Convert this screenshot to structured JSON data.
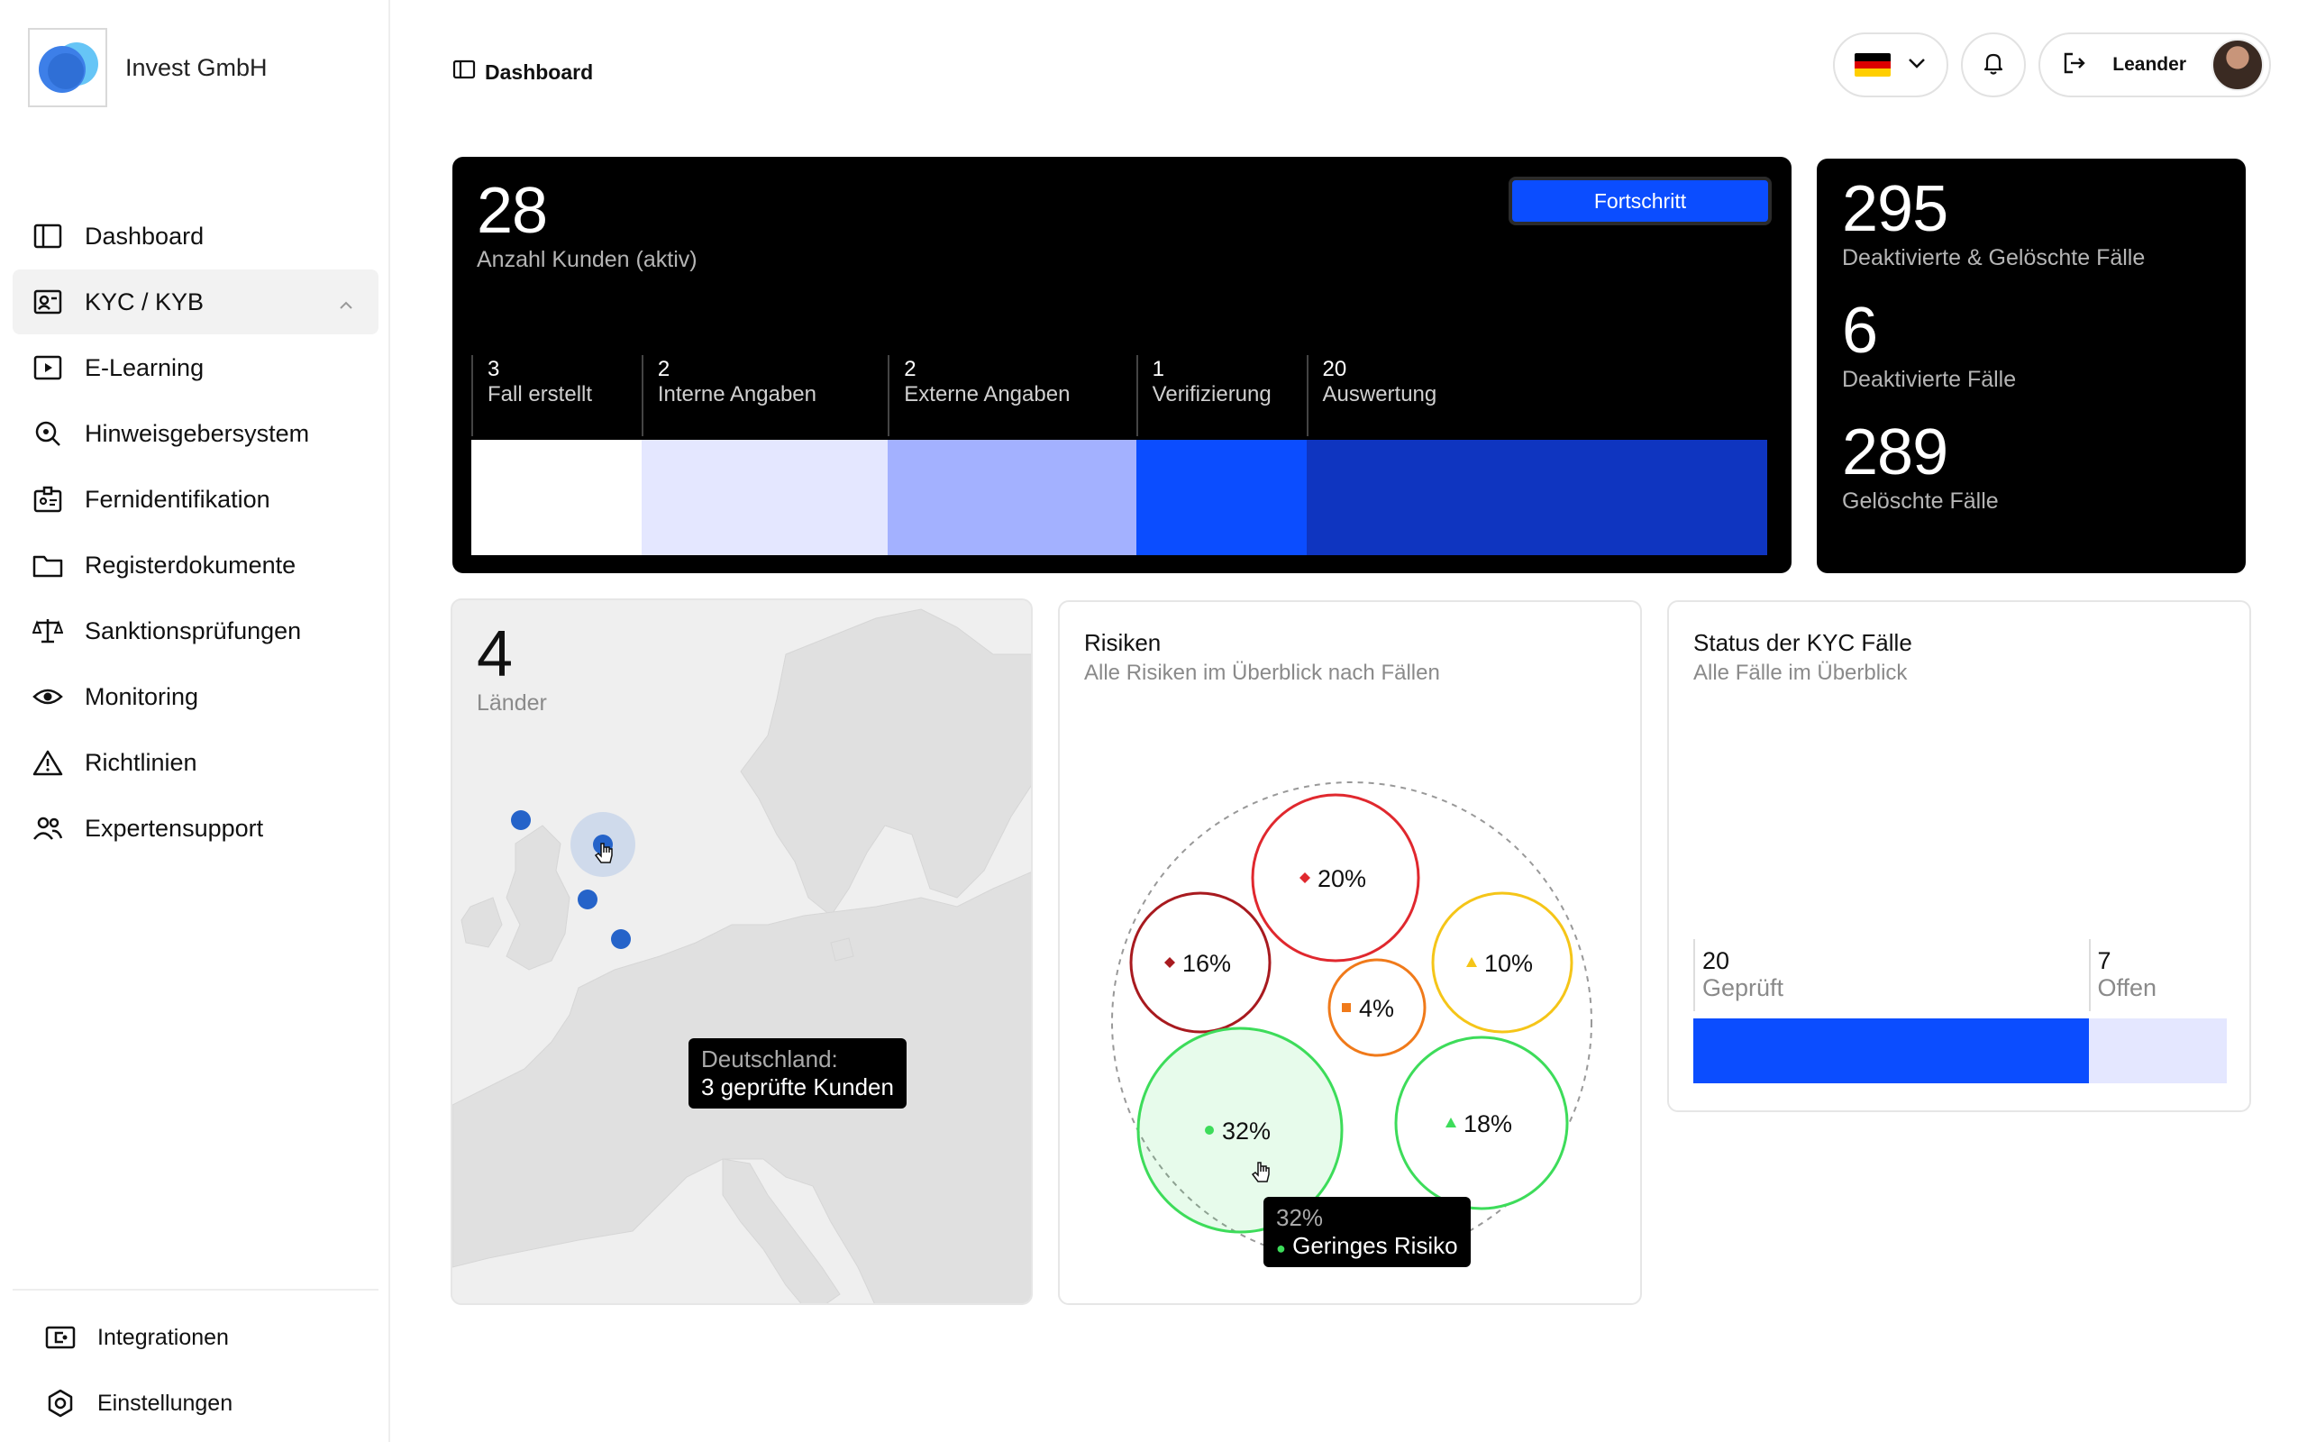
{
  "brand": {
    "name": "Invest GmbH"
  },
  "sidebar": {
    "items": [
      {
        "label": "Dashboard",
        "icon": "dashboard-icon"
      },
      {
        "label": "KYC / KYB",
        "icon": "id-card-icon",
        "active": true
      },
      {
        "label": "E-Learning",
        "icon": "play-icon"
      },
      {
        "label": "Hinweisgebersystem",
        "icon": "search-icon"
      },
      {
        "label": "Fernidentifikation",
        "icon": "badge-icon"
      },
      {
        "label": "Registerdokumente",
        "icon": "folder-icon"
      },
      {
        "label": "Sanktionsprüfungen",
        "icon": "scale-icon"
      },
      {
        "label": "Monitoring",
        "icon": "eye-icon"
      },
      {
        "label": "Richtlinien",
        "icon": "warning-icon"
      },
      {
        "label": "Expertensupport",
        "icon": "users-icon"
      }
    ],
    "bottom": [
      {
        "label": "Integrationen",
        "icon": "integration-icon"
      },
      {
        "label": "Einstellungen",
        "icon": "settings-icon"
      }
    ]
  },
  "header": {
    "breadcrumb": "Dashboard",
    "user_name": "Leander",
    "language": "Deutsch"
  },
  "customers": {
    "count": "28",
    "label": "Anzahl Kunden (aktiv)",
    "button": "Fortschritt",
    "stages": [
      {
        "count": "3",
        "label": "Fall erstellt",
        "color": "#ffffff",
        "value": 3
      },
      {
        "count": "2",
        "label": "Interne Angaben",
        "color": "#e4e7ff",
        "value": 2
      },
      {
        "count": "2",
        "label": "Externe Angaben",
        "color": "#a3b1ff",
        "value": 2
      },
      {
        "count": "1",
        "label": "Verifizierung",
        "color": "#0b4dff",
        "value": 1
      },
      {
        "count": "20",
        "label": "Auswertung",
        "color": "#0f35c0",
        "value": 20
      }
    ]
  },
  "cases": [
    {
      "count": "295",
      "label": "Deaktivierte & Gelöschte Fälle"
    },
    {
      "count": "6",
      "label": "Deaktivierte Fälle"
    },
    {
      "count": "289",
      "label": "Gelöschte Fälle"
    }
  ],
  "countries": {
    "count": "4",
    "label": "Länder",
    "tooltip_title": "Deutschland:",
    "tooltip_text": "3 geprüfte Kunden"
  },
  "risks": {
    "title": "Risiken",
    "subtitle": "Alle Risiken im Überblick nach Fällen",
    "bubbles": [
      {
        "label": "20%",
        "color": "#e0282e",
        "marker": "diamond"
      },
      {
        "label": "16%",
        "color": "#a81a1f",
        "marker": "diamond"
      },
      {
        "label": "10%",
        "color": "#f5c518",
        "marker": "triangle"
      },
      {
        "label": "4%",
        "color": "#f07a1a",
        "marker": "square"
      },
      {
        "label": "32%",
        "color": "#3ddc5a",
        "marker": "circle"
      },
      {
        "label": "18%",
        "color": "#3ddc5a",
        "marker": "triangle"
      }
    ],
    "tooltip_value": "32%",
    "tooltip_label": "Geringes Risiko"
  },
  "kyc_status": {
    "title": "Status der KYC Fälle",
    "subtitle": "Alle Fälle im Überblick",
    "segments": [
      {
        "count": "20",
        "label": "Geprüft",
        "color": "#0b4dff",
        "value": 20
      },
      {
        "count": "7",
        "label": "Offen",
        "color": "#e4e7ff",
        "value": 7
      }
    ]
  }
}
